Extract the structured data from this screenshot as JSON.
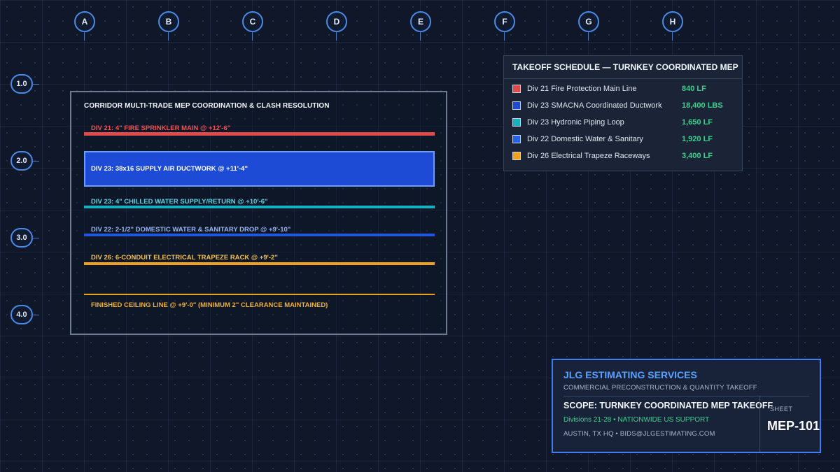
{
  "grid": {
    "columns": [
      "A",
      "B",
      "C",
      "D",
      "E",
      "F",
      "G",
      "H"
    ],
    "rows": [
      "1.0",
      "2.0",
      "3.0",
      "4.0"
    ]
  },
  "section": {
    "title": "CORRIDOR MULTI-TRADE MEP COORDINATION & CLASH RESOLUTION",
    "layers": {
      "fire": {
        "label": "DIV 21: 4\" FIRE SPRINKLER MAIN @ +12'-6\"",
        "color": "#e04a4a"
      },
      "duct": {
        "label": "DIV 23: 38x16 SUPPLY AIR DUCTWORK @ +11'-4\"",
        "color": "#1e4bd6"
      },
      "chw": {
        "label": "DIV 23: 4\" CHILLED WATER SUPPLY/RETURN @ +10'-6\"",
        "color": "#17b0c2"
      },
      "water": {
        "label": "DIV 22: 2-1/2\" DOMESTIC WATER & SANITARY DROP @ +9'-10\"",
        "color": "#2255e0"
      },
      "elec": {
        "label": "DIV 26: 6-CONDUIT ELECTRICAL TRAPEZE RACK @ +9'-2\"",
        "color": "#f0a01c"
      },
      "ceiling": {
        "label": "FINISHED CEILING LINE @ +9'-0\" (MINIMUM 2\" CLEARANCE MAINTAINED)",
        "color": "#e8a020"
      }
    }
  },
  "schedule": {
    "title": "TAKEOFF SCHEDULE — TURNKEY COORDINATED MEP",
    "items": [
      {
        "label": "Div 21 Fire Protection Main Line",
        "qty": "840 LF",
        "color": "#e04a4a"
      },
      {
        "label": "Div 23 SMACNA Coordinated Ductwork",
        "qty": "18,400 LBS",
        "color": "#1e4bd6"
      },
      {
        "label": "Div 23 Hydronic Piping Loop",
        "qty": "1,650 LF",
        "color": "#17b0c2"
      },
      {
        "label": "Div 22 Domestic Water & Sanitary",
        "qty": "1,920 LF",
        "color": "#2563eb"
      },
      {
        "label": "Div 26 Electrical Trapeze Raceways",
        "qty": "3,400 LF",
        "color": "#f0a01c"
      }
    ]
  },
  "titleblock": {
    "company": "JLG ESTIMATING SERVICES",
    "tagline": "COMMERCIAL PRECONSTRUCTION & QUANTITY TAKEOFF",
    "scope": "SCOPE: TURNKEY COORDINATED MEP TAKEOFF",
    "divisions": "Divisions 21-28 • NATIONWIDE US SUPPORT",
    "contact": "AUSTIN, TX HQ • BIDS@JLGESTIMATING.COM",
    "sheet_label": "SHEET",
    "sheet_number": "MEP-101"
  }
}
